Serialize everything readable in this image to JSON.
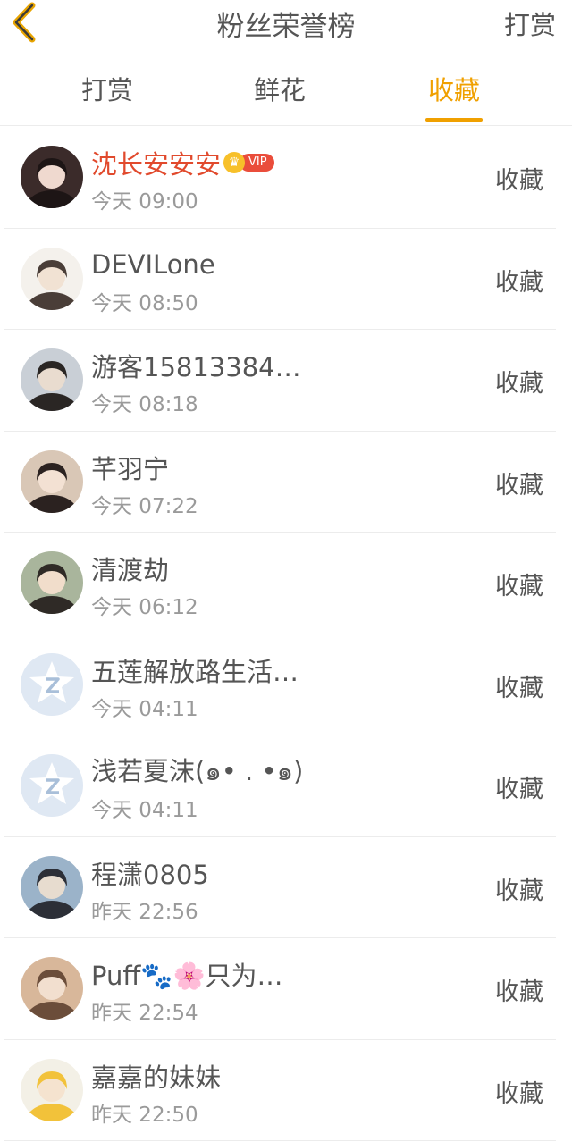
{
  "nav": {
    "title": "粉丝荣誉榜",
    "right_label": "打赏",
    "back_icon": "chevron-left-icon",
    "accent": "#f0a000"
  },
  "tabs": [
    {
      "label": "打赏",
      "active": false
    },
    {
      "label": "鲜花",
      "active": false
    },
    {
      "label": "收藏",
      "active": true
    }
  ],
  "fans": [
    {
      "name": "沈长安安安",
      "time": "今天 09:00",
      "action": "收藏",
      "vip": true,
      "vip_label": "VIP",
      "avatar": "dark"
    },
    {
      "name": "DEVILone",
      "time": "今天 08:50",
      "action": "收藏",
      "vip": false,
      "avatar": "light"
    },
    {
      "name": "游客15813384…",
      "time": "今天 08:18",
      "action": "收藏",
      "vip": false,
      "avatar": "photo"
    },
    {
      "name": "芊羽宁",
      "time": "今天 07:22",
      "action": "收藏",
      "vip": false,
      "avatar": "girl"
    },
    {
      "name": "清渡劫",
      "time": "今天 06:12",
      "action": "收藏",
      "vip": false,
      "avatar": "boy"
    },
    {
      "name": "五莲解放路生活…",
      "time": "今天 04:11",
      "action": "收藏",
      "vip": false,
      "avatar": "default"
    },
    {
      "name": "浅若夏沫(๑• . •๑)",
      "time": "今天 04:11",
      "action": "收藏",
      "vip": false,
      "avatar": "default"
    },
    {
      "name": "程潇0805",
      "time": "昨天 22:56",
      "action": "收藏",
      "vip": false,
      "avatar": "blue"
    },
    {
      "name": "Puff🐾🌸只为…",
      "time": "昨天 22:54",
      "action": "收藏",
      "vip": false,
      "avatar": "warm"
    },
    {
      "name": "嘉嘉的妹妹",
      "time": "昨天 22:50",
      "action": "收藏",
      "vip": false,
      "avatar": "yellow"
    }
  ]
}
